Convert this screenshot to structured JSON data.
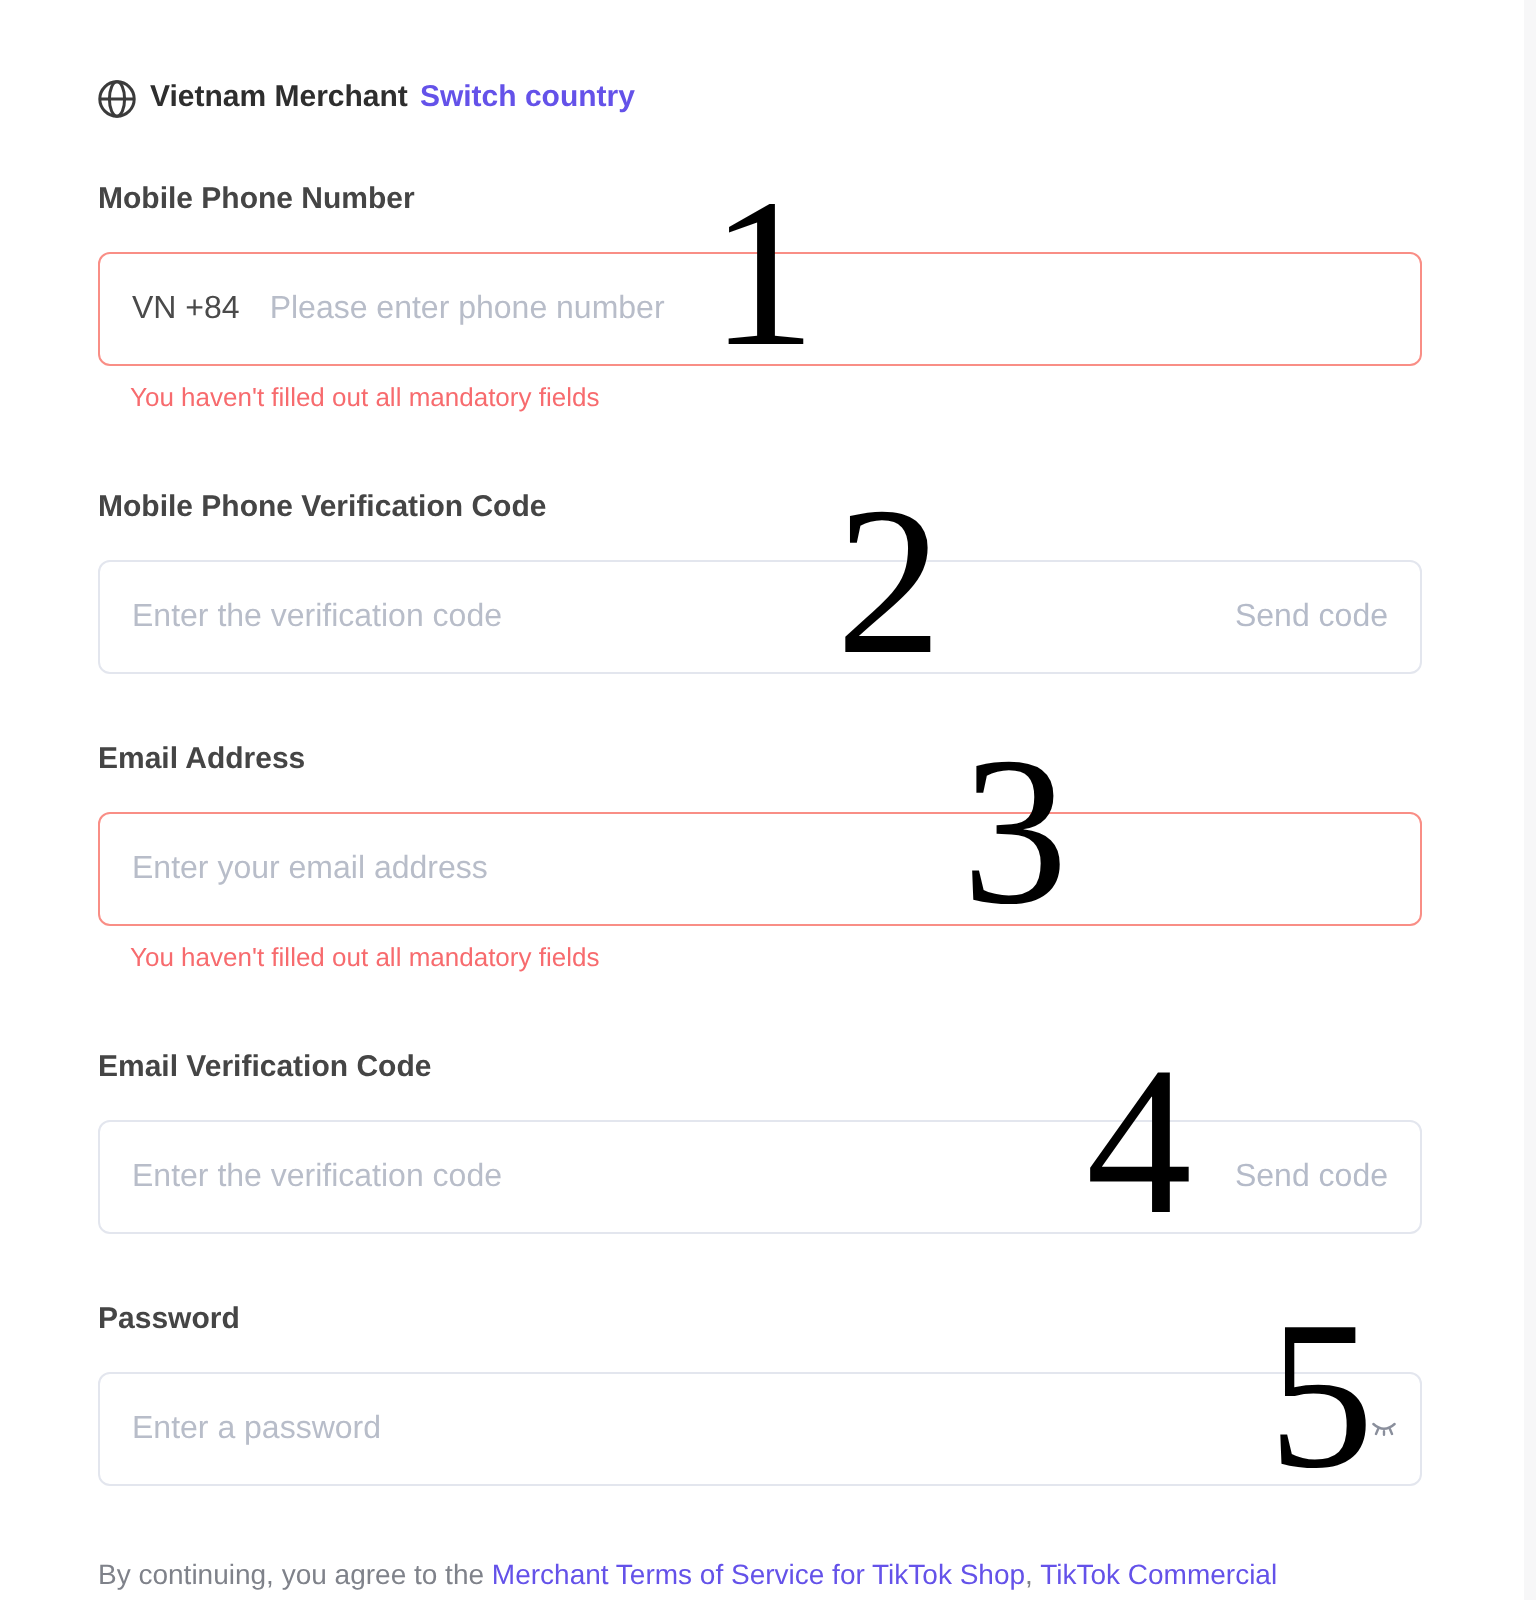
{
  "header": {
    "region": "Vietnam Merchant",
    "link": "Switch country"
  },
  "fields": [
    {
      "kind": "phone",
      "label": "Mobile Phone Number",
      "prefix": "VN +84",
      "placeholder": "Please enter phone number",
      "error": "You haven't filled out all mandatory fields",
      "marker": "1"
    },
    {
      "kind": "code",
      "label": "Mobile Phone Verification Code",
      "placeholder": "Enter the verification code",
      "action": "Send code",
      "marker": "2"
    },
    {
      "kind": "text",
      "label": "Email Address",
      "placeholder": "Enter your email address",
      "error": "You haven't filled out all mandatory fields",
      "marker": "3"
    },
    {
      "kind": "code",
      "label": "Email Verification Code",
      "placeholder": "Enter the verification code",
      "action": "Send code",
      "marker": "4"
    },
    {
      "kind": "password",
      "label": "Password",
      "placeholder": "Enter a password",
      "password_visible": false,
      "marker": "5"
    }
  ],
  "terms": {
    "lead": "By continuing, you agree to the ",
    "links": [
      "Merchant Terms of Service for TikTok Shop",
      "TikTok Commercial"
    ],
    "separator": ", "
  }
}
